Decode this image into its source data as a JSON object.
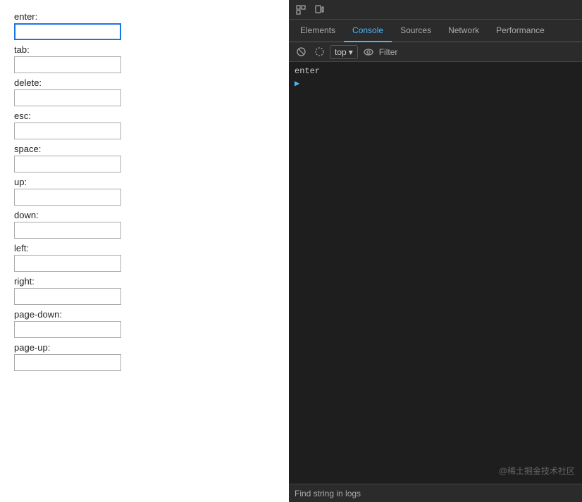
{
  "left": {
    "fields": [
      {
        "id": "enter",
        "label": "enter:",
        "active": true
      },
      {
        "id": "tab",
        "label": "tab:",
        "active": false
      },
      {
        "id": "delete",
        "label": "delete:",
        "active": false
      },
      {
        "id": "esc",
        "label": "esc:",
        "active": false
      },
      {
        "id": "space",
        "label": "space:",
        "active": false
      },
      {
        "id": "up",
        "label": "up:",
        "active": false
      },
      {
        "id": "down",
        "label": "down:",
        "active": false
      },
      {
        "id": "left",
        "label": "left:",
        "active": false
      },
      {
        "id": "right",
        "label": "right:",
        "active": false
      },
      {
        "id": "page-down",
        "label": "page-down:",
        "active": false
      },
      {
        "id": "page-up",
        "label": "page-up:",
        "active": false
      }
    ]
  },
  "devtools": {
    "tabs": [
      "Elements",
      "Console",
      "Sources",
      "Network",
      "Performance"
    ],
    "active_tab": "Console",
    "top_selector": "top",
    "filter_placeholder": "Filter",
    "console_lines": [
      "enter"
    ],
    "find_label": "Find string in logs",
    "icons": {
      "inspect": "⬜",
      "device": "☐",
      "clear": "🚫",
      "stop": "⊘",
      "eye": "👁"
    }
  }
}
